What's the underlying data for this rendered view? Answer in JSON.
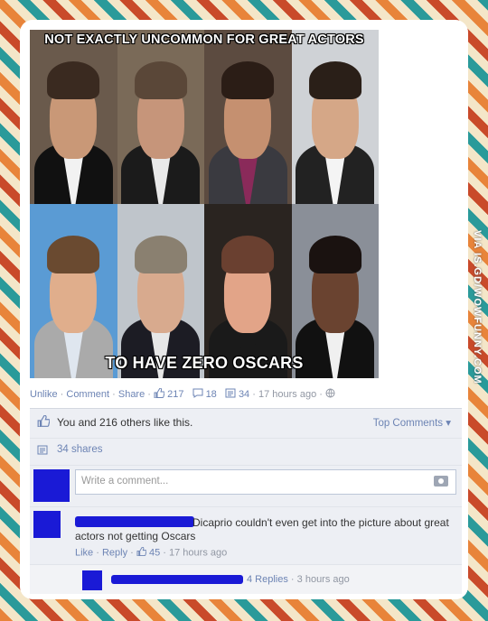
{
  "meme": {
    "top_text": "NOT EXACTLY UNCOMMON FOR GREAT ACTORS",
    "bottom_text": "TO HAVE ZERO OSCARS",
    "cells": [
      {
        "bg": "#6a5a4c",
        "skin": "#c99877",
        "hair": "#3a2a20",
        "suit": "#111111",
        "shirt": "#f2f2f2"
      },
      {
        "bg": "#7a6a58",
        "skin": "#c6957a",
        "hair": "#5a4738",
        "suit": "#1b1b1b",
        "shirt": "#e9e9e9"
      },
      {
        "bg": "#5c4b40",
        "skin": "#c59070",
        "hair": "#2b1d16",
        "suit": "#3a3a40",
        "shirt": "#8a2a5a"
      },
      {
        "bg": "#cfd2d6",
        "skin": "#d5a787",
        "hair": "#2a1f18",
        "suit": "#222222",
        "shirt": "#f4f4f4"
      },
      {
        "bg": "#5a9bd4",
        "skin": "#e0ae8c",
        "hair": "#6a4a30",
        "suit": "#aaaaaa",
        "shirt": "#dfe6ef"
      },
      {
        "bg": "#bfc5cb",
        "skin": "#d8aa8e",
        "hair": "#8a8070",
        "suit": "#1c1c24",
        "shirt": "#e7e7e7"
      },
      {
        "bg": "#2a2420",
        "skin": "#e2a488",
        "hair": "#6a4030",
        "suit": "#1a1a1a",
        "shirt": "#1a1a1a"
      },
      {
        "bg": "#8a8f98",
        "skin": "#6a4330",
        "hair": "#1a1210",
        "suit": "#111111",
        "shirt": "#f0f0f0"
      }
    ]
  },
  "watermark": "VIA IS.GD/WOWFUNNY.COM",
  "actions": {
    "unlike": "Unlike",
    "comment": "Comment",
    "share": "Share",
    "likes": "217",
    "comments": "18",
    "shares": "34",
    "time": "17 hours ago"
  },
  "panel": {
    "likes_text": "You and 216 others like this.",
    "top_comments": "Top Comments",
    "shares_text": "34 shares",
    "write_placeholder": "Write a comment...",
    "comment": {
      "text": "Dicaprio couldn't even get into the picture about great actors not getting Oscars",
      "like": "Like",
      "reply": "Reply",
      "likes": "45",
      "time": "17 hours ago"
    },
    "replies": {
      "count": "4 Replies",
      "time": "3 hours ago"
    }
  },
  "colors": {
    "link": "#6d84b4",
    "redaction": "#1a1ad6"
  }
}
